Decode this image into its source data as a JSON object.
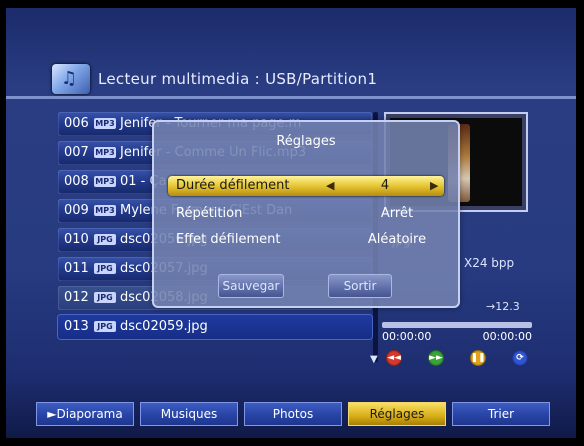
{
  "header": {
    "title": "Lecteur multimedia : USB/Partition1"
  },
  "file_list": [
    {
      "num": "006",
      "type": "MP3",
      "name": "Jenifer - Tourner ma page.m",
      "state": "normal"
    },
    {
      "num": "007",
      "type": "MP3",
      "name": "Jenifer - Comme Un Flic.mp3",
      "state": "normal"
    },
    {
      "num": "008",
      "type": "MP3",
      "name": "01 - Ça Ira.mp3",
      "state": "normal"
    },
    {
      "num": "009",
      "type": "MP3",
      "name": "Mylene Farmer - C'Est Dan",
      "state": "normal"
    },
    {
      "num": "010",
      "type": "JPG",
      "name": "dsc02056.jpg",
      "state": "normal"
    },
    {
      "num": "011",
      "type": "JPG",
      "name": "dsc02057.jpg",
      "state": "normal"
    },
    {
      "num": "012",
      "type": "JPG",
      "name": "dsc02058.jpg",
      "state": "dim",
      "marked": true
    },
    {
      "num": "013",
      "type": "JPG",
      "name": "dsc02059.jpg",
      "state": "selected"
    }
  ],
  "preview": {
    "extension": "jpg",
    "resolution": "X24 bpp",
    "page_indicator": "→12.3"
  },
  "player": {
    "elapsed": "00:00:00",
    "total": "00:00:00",
    "buttons": [
      "red",
      "green",
      "yellow",
      "blue"
    ]
  },
  "dialog": {
    "title": "Réglages",
    "settings": [
      {
        "label": "Durée défilement",
        "value": "4",
        "highlight": true
      },
      {
        "label": "Répétition",
        "value": "Arrêt"
      },
      {
        "label": "Effet défilement",
        "value": "Aléatoire"
      }
    ],
    "save_label": "Sauvegar",
    "exit_label": "Sortir"
  },
  "bottom_menu": [
    {
      "label": "►Diaporama",
      "active": false
    },
    {
      "label": "Musiques",
      "active": false
    },
    {
      "label": "Photos",
      "active": false
    },
    {
      "label": "Réglages",
      "active": true
    },
    {
      "label": "Trier",
      "active": false
    }
  ],
  "colors": {
    "background": "#26397d",
    "highlight": "#e6c633",
    "button": "#2a46a8",
    "red": "#d63a2c",
    "green": "#3aa33a",
    "yellow": "#e0a21d",
    "blue": "#2f54d6"
  },
  "icons": {
    "title_icon": "music-folder-icon",
    "scroll_indicator": "scroll-down-arrow",
    "check_mark": "check-icon"
  }
}
